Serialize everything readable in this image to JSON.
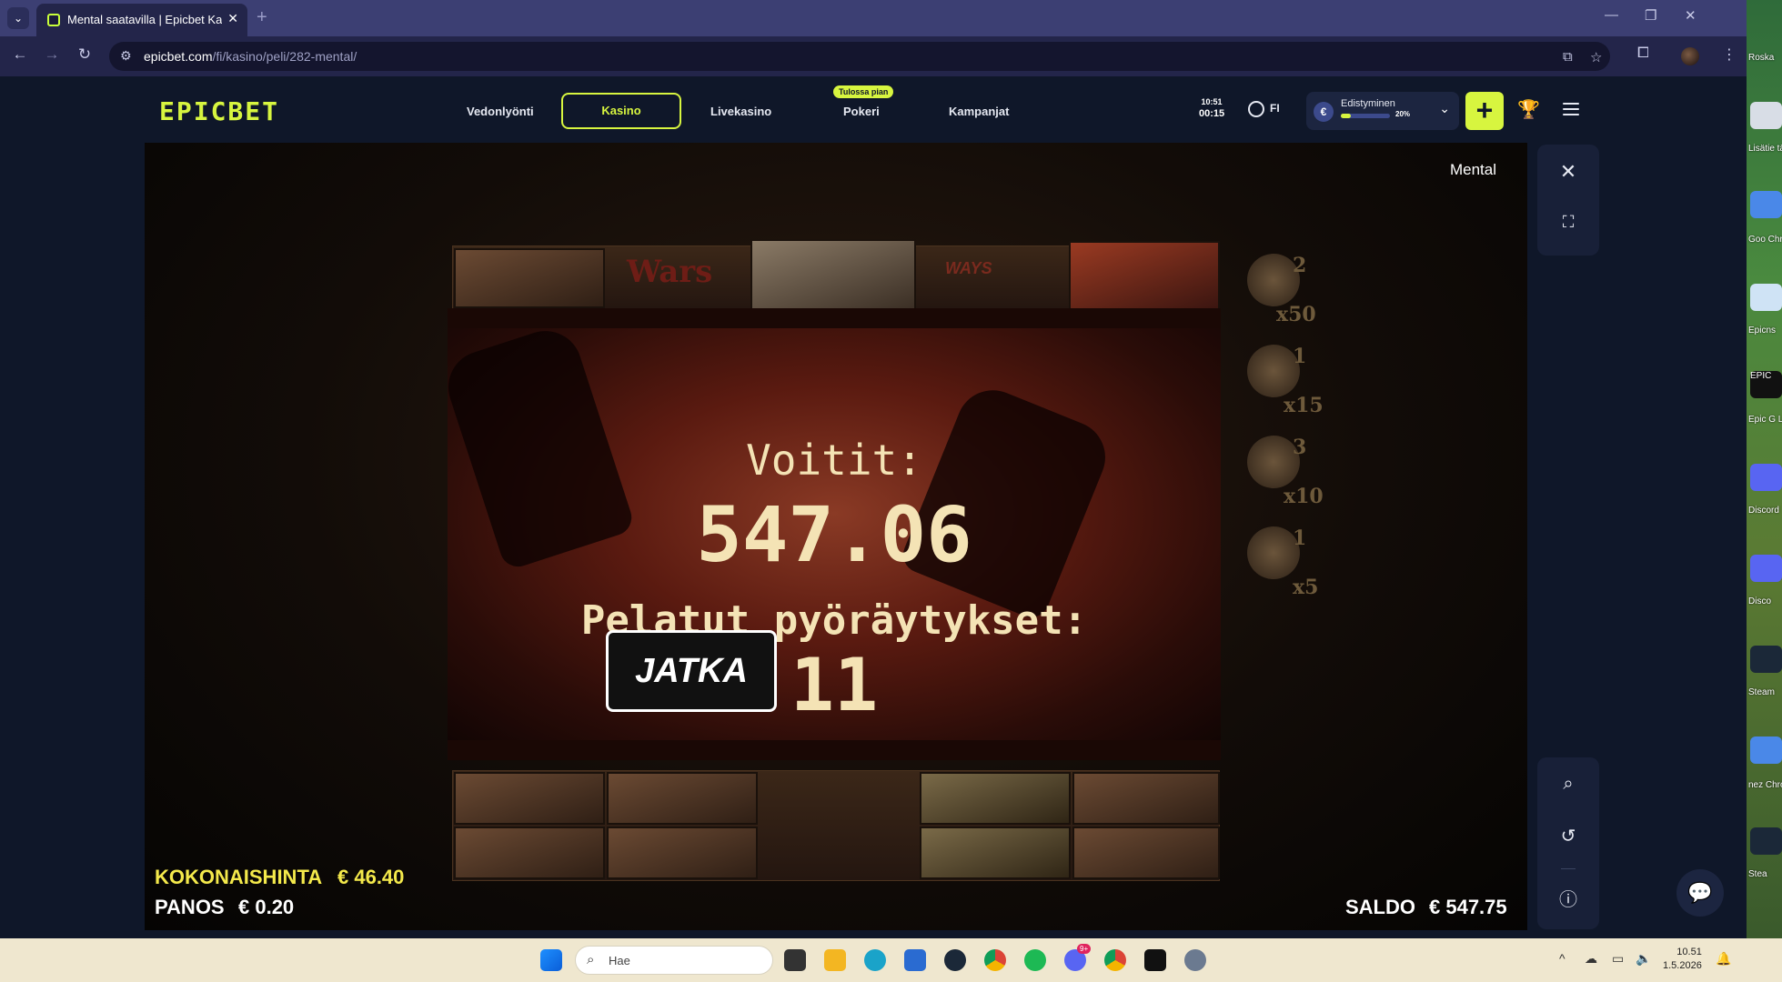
{
  "browser": {
    "tab_title": "Mental saatavilla | Epicbet Kasino",
    "new_tab": "+",
    "url_host": "epicbet.com",
    "url_path": "/fi/kasino/peli/282-mental/"
  },
  "site": {
    "logo": "EPICBET",
    "nav": [
      "Vedonlyönti",
      "Kasino",
      "Livekasino",
      "Pokeri",
      "Kampanjat"
    ],
    "soon_badge": "Tulossa pian",
    "clock_time": "10:51",
    "clock_session": "00:15",
    "language": "FI",
    "progress_label": "Edistyminen",
    "progress_pct_text": "20%",
    "progress_value": 0.2,
    "currency_symbol": "€",
    "accent_color": "#d7f53f"
  },
  "game": {
    "name": "Mental",
    "win_label": "Voitit:",
    "win_amount": "547.06",
    "spins_label": "Pelatut pyöräytykset:",
    "spins_count": "11",
    "continue_button": "JATKA",
    "multipliers": [
      {
        "count": "2",
        "mult": "x50"
      },
      {
        "count": "1",
        "mult": "x15"
      },
      {
        "count": "3",
        "mult": "x10"
      },
      {
        "count": "1",
        "mult": "x5"
      }
    ],
    "reel_texts": [
      "Wars",
      "WAYS"
    ],
    "total_cost_label": "KOKONAISHINTA",
    "total_cost_value": "€ 46.40",
    "bet_label": "PANOS",
    "bet_value": "€ 0.20",
    "balance_label": "SALDO",
    "balance_value": "€ 547.75"
  },
  "desktop_icons": [
    "Roska",
    "Lisätie tästä k",
    "Goo Chro",
    "Epicns",
    "EPIC",
    "Epic G Laun",
    "Discord",
    "Disco",
    "Steam",
    "nez Chro",
    "Stea"
  ],
  "taskbar": {
    "search_placeholder": "Hae",
    "time": "10.51",
    "date": "1.5.2026",
    "discord_badge": "9+"
  }
}
